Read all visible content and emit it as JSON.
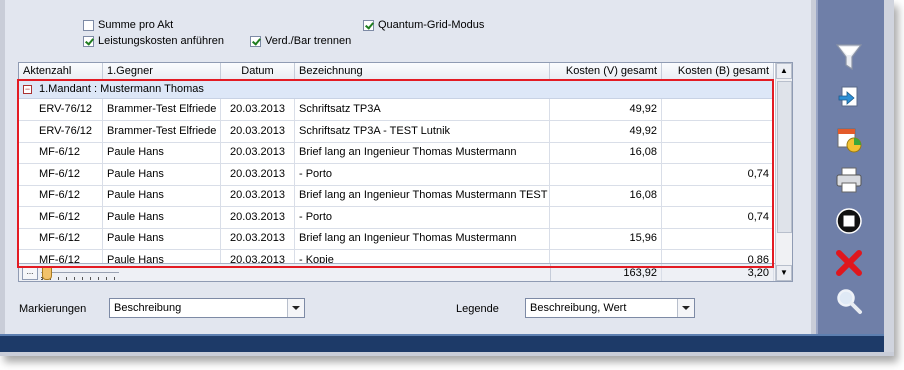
{
  "options": {
    "summe_pro_akt": {
      "label": "Summe pro Akt",
      "checked": false
    },
    "leistungskosten": {
      "label": "Leistungskosten anführen",
      "checked": true
    },
    "verd_bar": {
      "label": "Verd./Bar trennen",
      "checked": true
    },
    "quantum_grid": {
      "label": "Quantum-Grid-Modus",
      "checked": true
    }
  },
  "grid": {
    "columns": [
      "Aktenzahl",
      "1.Gegner",
      "Datum",
      "Bezeichnung",
      "Kosten (V) gesamt",
      "Kosten (B) gesamt"
    ],
    "group_label": "1.Mandant : Mustermann Thomas",
    "rows": [
      {
        "aktenzahl": "ERV-76/12",
        "gegner": "Brammer-Test Elfriede",
        "datum": "20.03.2013",
        "bezeichnung": "Schriftsatz TP3A",
        "kosten_v": "49,92",
        "kosten_b": ""
      },
      {
        "aktenzahl": "ERV-76/12",
        "gegner": "Brammer-Test Elfriede",
        "datum": "20.03.2013",
        "bezeichnung": "Schriftsatz TP3A - TEST Lutnik",
        "kosten_v": "49,92",
        "kosten_b": ""
      },
      {
        "aktenzahl": "MF-6/12",
        "gegner": "Paule Hans",
        "datum": "20.03.2013",
        "bezeichnung": "Brief lang an Ingenieur Thomas Mustermann",
        "kosten_v": "16,08",
        "kosten_b": ""
      },
      {
        "aktenzahl": "MF-6/12",
        "gegner": "Paule Hans",
        "datum": "20.03.2013",
        "bezeichnung": "- Porto",
        "kosten_v": "",
        "kosten_b": "0,74"
      },
      {
        "aktenzahl": "MF-6/12",
        "gegner": "Paule Hans",
        "datum": "20.03.2013",
        "bezeichnung": "Brief lang an Ingenieur Thomas Mustermann TEST",
        "kosten_v": "16,08",
        "kosten_b": ""
      },
      {
        "aktenzahl": "MF-6/12",
        "gegner": "Paule Hans",
        "datum": "20.03.2013",
        "bezeichnung": "- Porto",
        "kosten_v": "",
        "kosten_b": "0,74"
      },
      {
        "aktenzahl": "MF-6/12",
        "gegner": "Paule Hans",
        "datum": "20.03.2013",
        "bezeichnung": "Brief lang an Ingenieur Thomas Mustermann",
        "kosten_v": "15,96",
        "kosten_b": ""
      },
      {
        "aktenzahl": "MF-6/12",
        "gegner": "Paule Hans",
        "datum": "20.03.2013",
        "bezeichnung": "- Kopie",
        "kosten_v": "",
        "kosten_b": "0,86"
      }
    ],
    "footer": {
      "button": "...",
      "total_v": "163,92",
      "total_b": "3,20"
    }
  },
  "bottom": {
    "markierungen_label": "Markierungen",
    "markierungen_value": "Beschreibung",
    "legende_label": "Legende",
    "legende_value": "Beschreibung, Wert"
  },
  "toolbar": {
    "icons": [
      "filter-icon",
      "export-icon",
      "calendar-chart-icon",
      "printer-icon",
      "stop-icon",
      "close-icon",
      "search-icon"
    ]
  },
  "colors": {
    "selection_border": "#e31b23",
    "group_row": "#dde7f7",
    "panel": "#6f7fa8",
    "bottom_bar": "#1d3a68"
  }
}
